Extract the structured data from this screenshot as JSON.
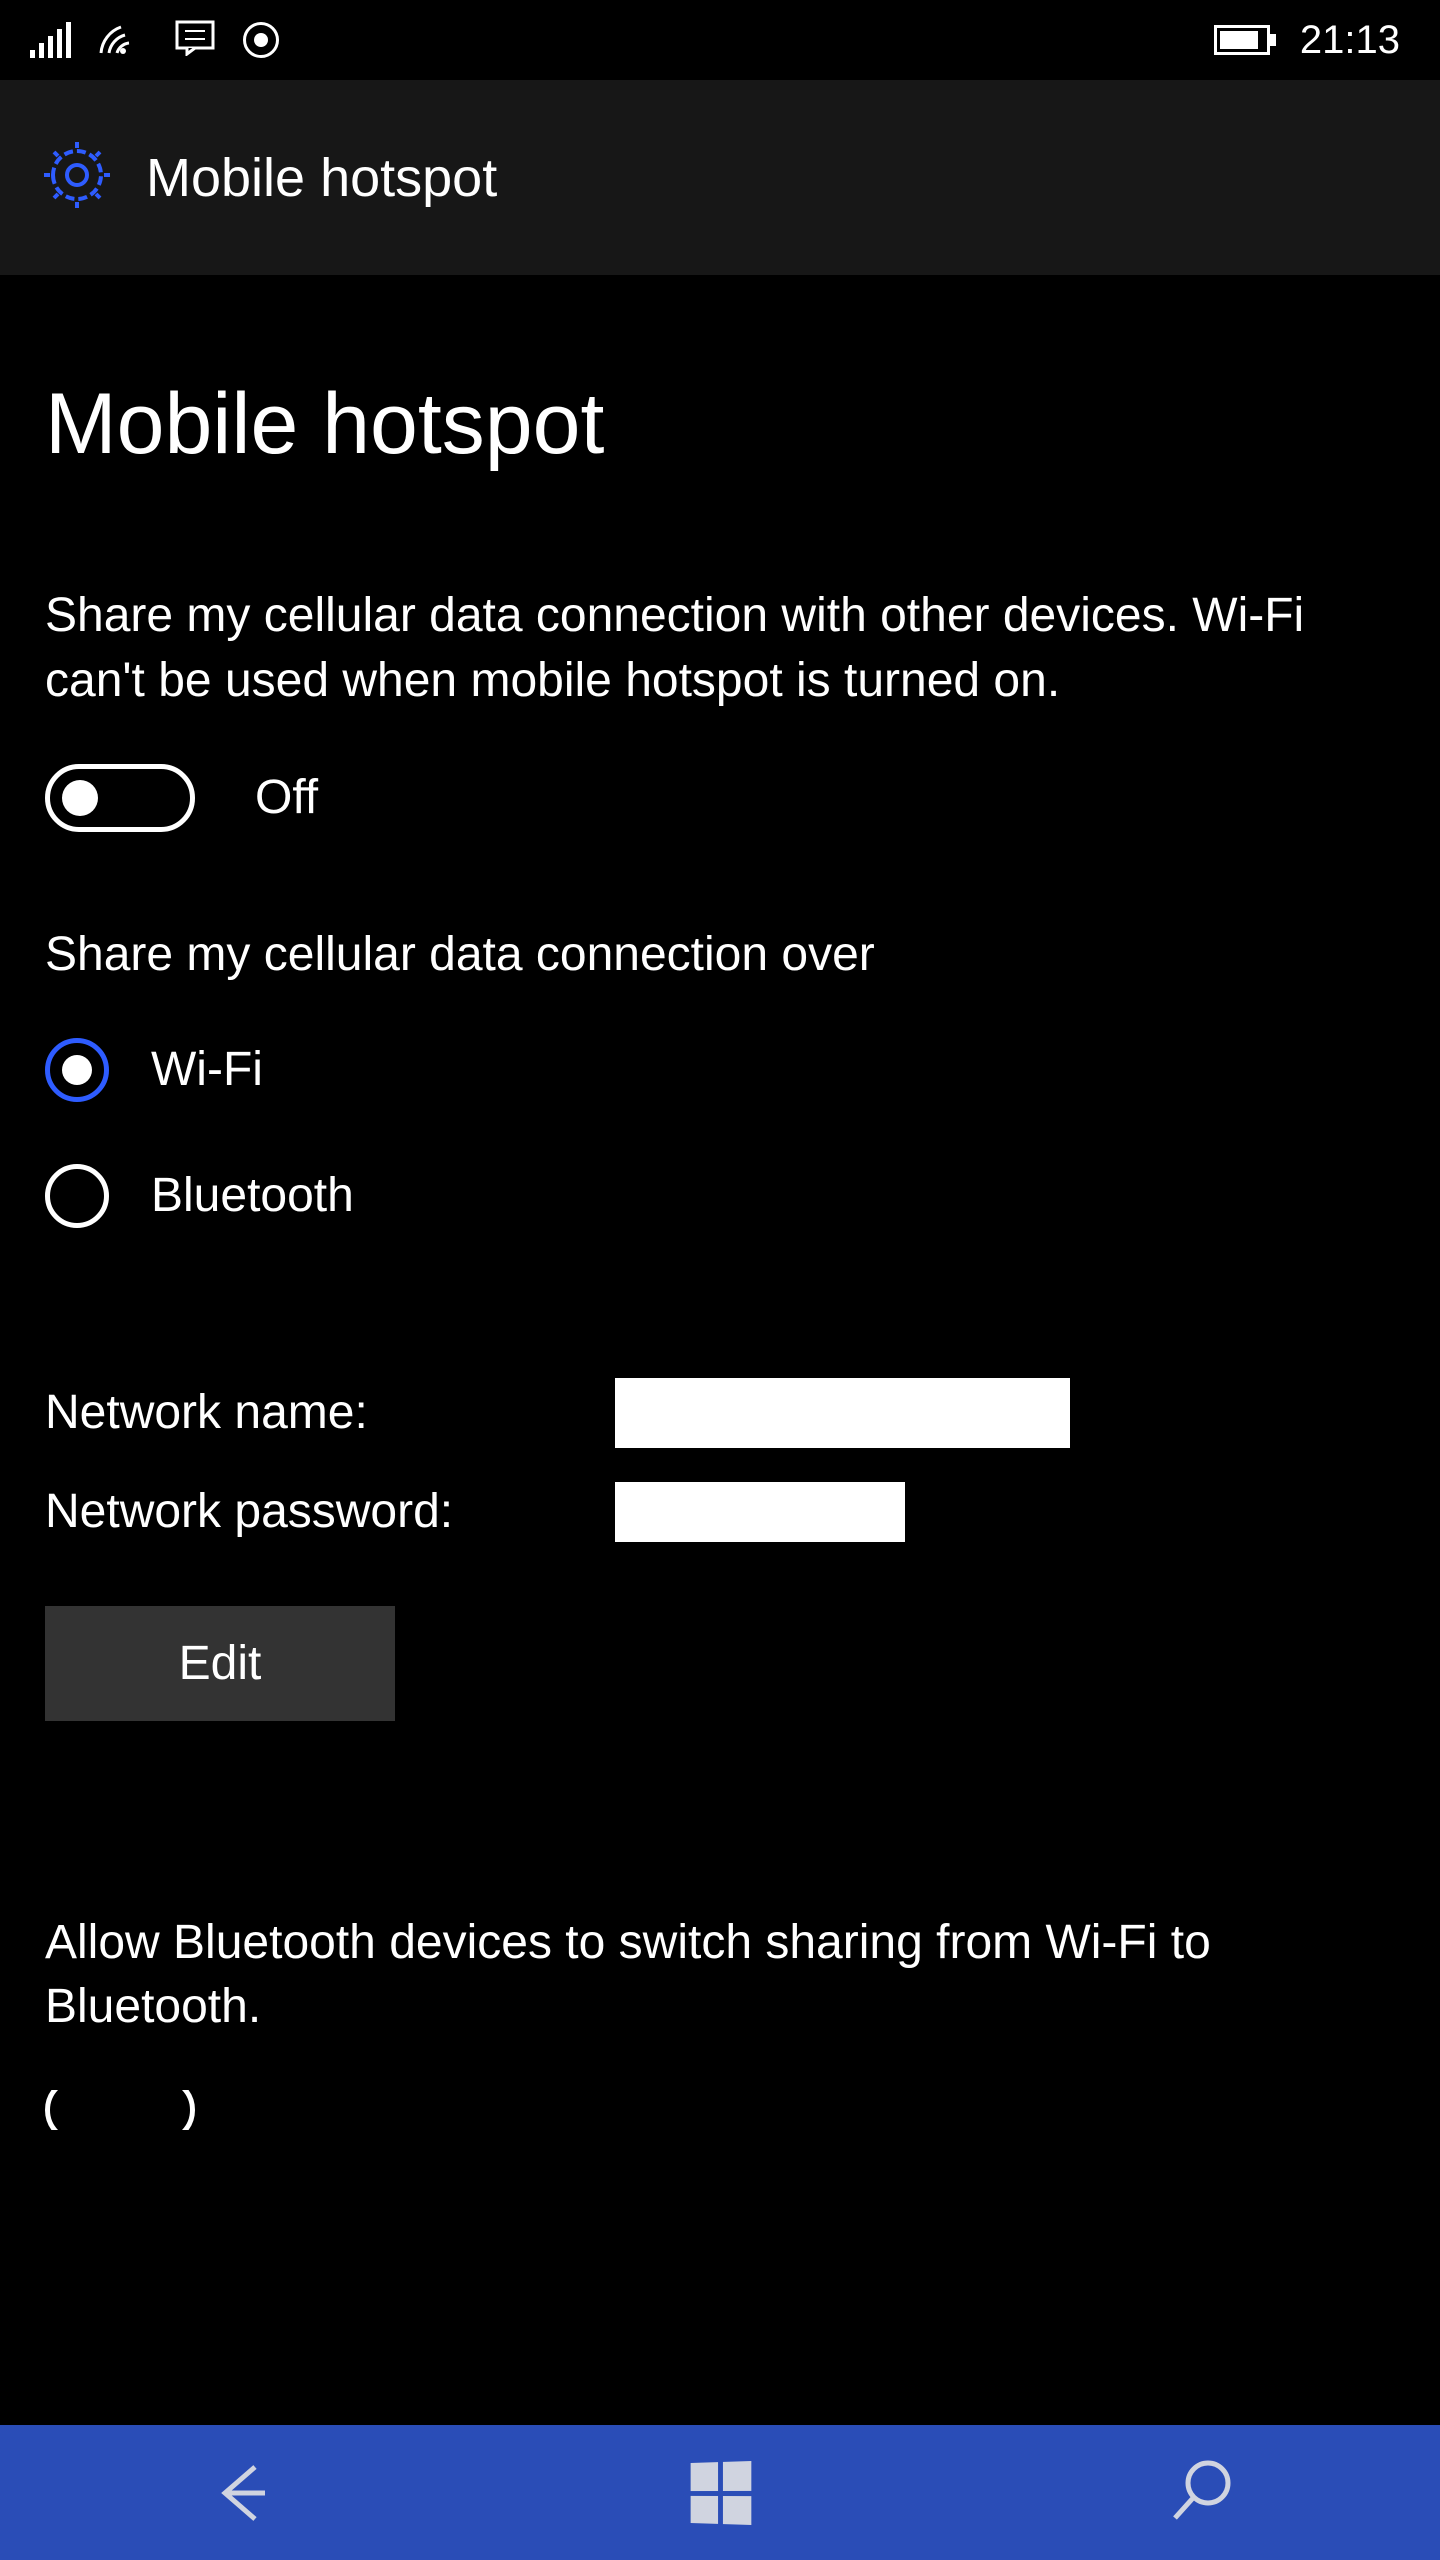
{
  "statusBar": {
    "time": "21:13"
  },
  "header": {
    "title": "Mobile hotspot"
  },
  "page": {
    "title": "Mobile hotspot",
    "description": "Share my cellular data connection with other devices. Wi-Fi can't be used when mobile hotspot is turned on."
  },
  "mainToggle": {
    "state": "Off"
  },
  "shareOver": {
    "label": "Share my cellular data connection over",
    "options": {
      "wifi": "Wi-Fi",
      "bluetooth": "Bluetooth"
    }
  },
  "network": {
    "nameLabel": "Network name:",
    "passwordLabel": "Network password:",
    "editButton": "Edit"
  },
  "bluetooth": {
    "description": "Allow Bluetooth devices to switch sharing from Wi-Fi to Bluetooth."
  }
}
